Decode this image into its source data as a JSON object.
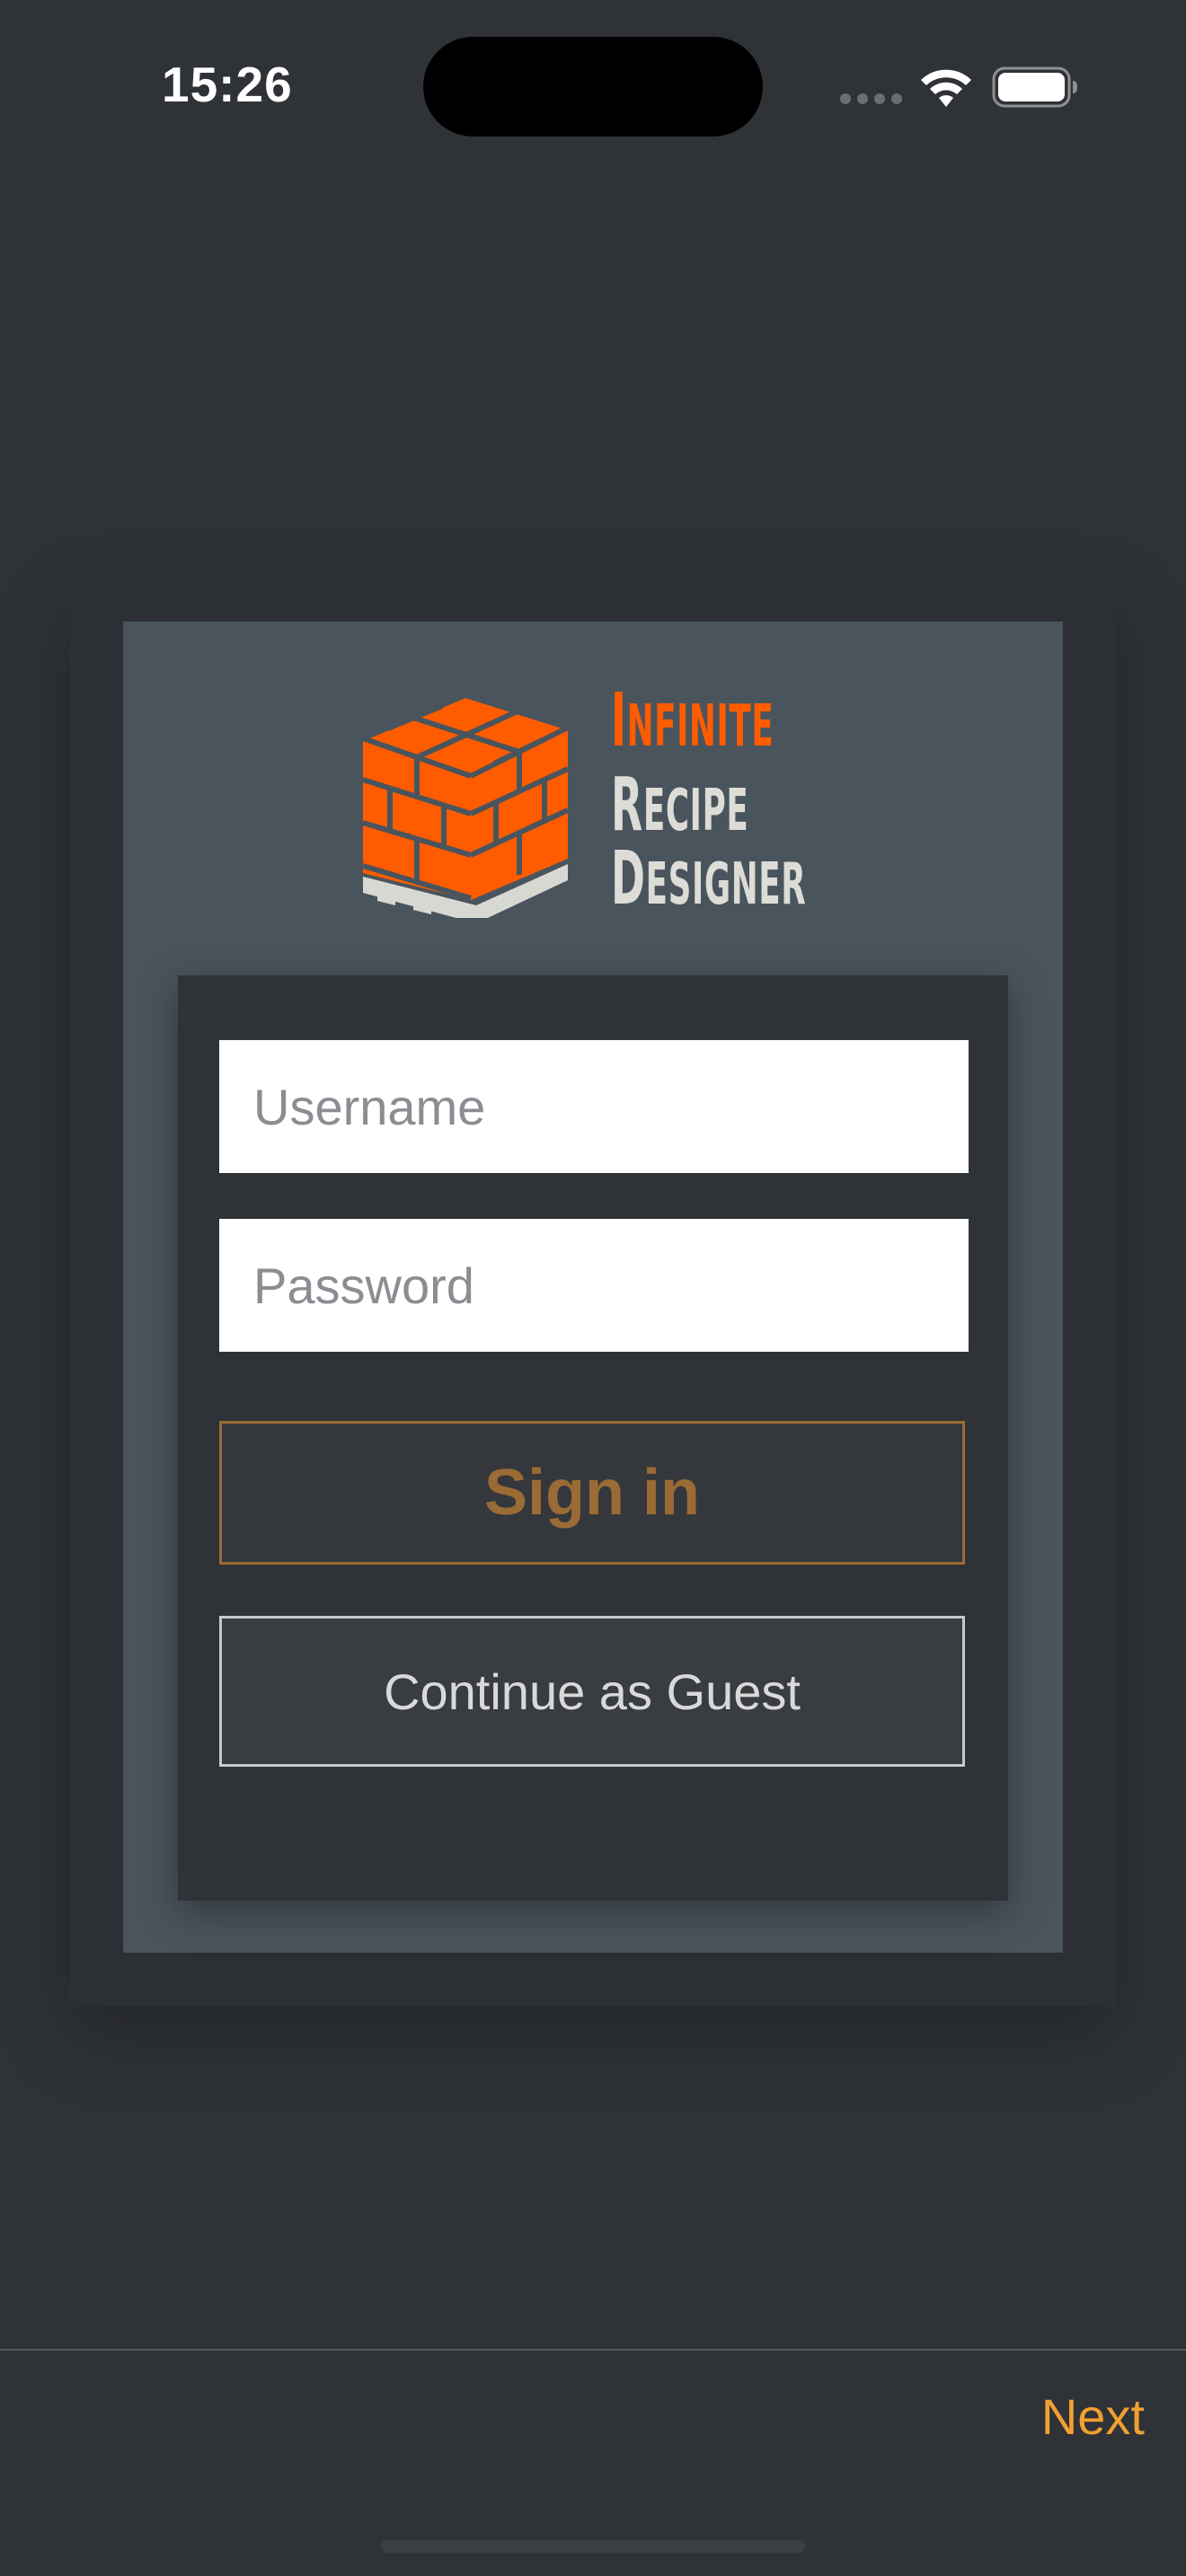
{
  "status_bar": {
    "time": "15:26",
    "icons": [
      "cellular-signal-icon",
      "wifi-icon",
      "battery-icon"
    ]
  },
  "logo": {
    "line1_initial": "I",
    "line1_rest": "NFINITE",
    "line2_initial": "R",
    "line2_rest": "ECIPE",
    "line3_initial": "D",
    "line3_rest": "ESIGNER",
    "colors": {
      "accent": "#ff5c00",
      "text": "#dddcd6"
    }
  },
  "form": {
    "username_placeholder": "Username",
    "username_value": "",
    "password_placeholder": "Password",
    "password_value": "",
    "sign_in_label": "Sign in",
    "guest_label": "Continue as Guest"
  },
  "toolbar": {
    "next_label": "Next"
  },
  "colors": {
    "background": "#2f3236",
    "card": "#4a545d",
    "sign_in_accent": "#9b6b35",
    "next_accent": "#f0a030"
  }
}
